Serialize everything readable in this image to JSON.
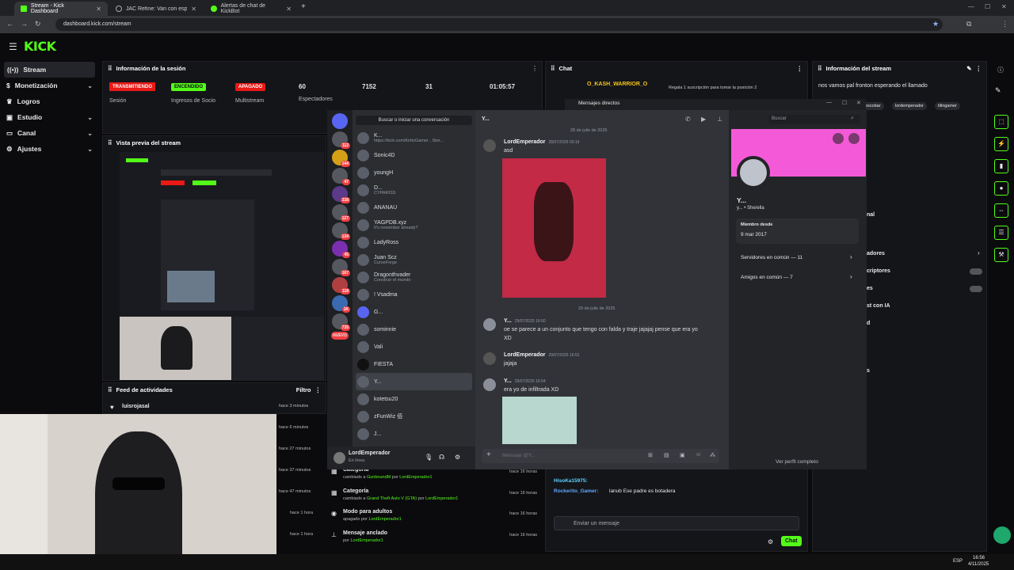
{
  "browser": {
    "tabs": [
      {
        "label": "Stream - Kick Dashboard",
        "active": true
      },
      {
        "label": "JAC Refine: Van con espacio y c...",
        "active": false
      },
      {
        "label": "Alertas de chat de KickBot",
        "active": false
      }
    ],
    "url": "dashboard.kick.com/stream"
  },
  "kick": {
    "logo": "KICK",
    "sidebar": [
      {
        "label": "Stream",
        "icon": "broadcast-icon",
        "active": true,
        "chevron": false
      },
      {
        "label": "Monetización",
        "icon": "coin-icon",
        "active": false,
        "chevron": true
      },
      {
        "label": "Logros",
        "icon": "trophy-icon",
        "active": false,
        "chevron": false
      },
      {
        "label": "Estudio",
        "icon": "studio-icon",
        "active": false,
        "chevron": true
      },
      {
        "label": "Canal",
        "icon": "channel-icon",
        "active": false,
        "chevron": true
      },
      {
        "label": "Ajustes",
        "icon": "gear-icon",
        "active": false,
        "chevron": true
      }
    ],
    "session": {
      "title": "Información de la sesión",
      "stats": [
        {
          "value": "TRANSMITIENDO",
          "label": "Sesión",
          "color": "#e91916"
        },
        {
          "value": "ENCENDIDO",
          "label": "Ingresos de Socio",
          "color": "#53fc18"
        },
        {
          "value": "APAGADO",
          "label": "Multistream",
          "color": "#e91916"
        },
        {
          "value": "60",
          "label": "Espectadores",
          "color": ""
        },
        {
          "value": "7152",
          "label": "",
          "color": ""
        },
        {
          "value": "31",
          "label": "",
          "color": ""
        },
        {
          "value": "01:05:57",
          "label": "",
          "color": ""
        }
      ]
    },
    "preview": {
      "title": "Vista previa del stream"
    },
    "activity": {
      "title": "Feed de actividades",
      "filter": "Filtro",
      "first_user": "luisrojasal",
      "times_left": [
        "hace 3 minutos",
        "hace 6 minutos",
        "hace 27 minutos",
        "hace 37 minutos",
        "hace 47 minutos",
        "hace 1 hora",
        "hace 1 hora"
      ],
      "rows": [
        {
          "title": "Categoría",
          "detail_prefix": "cambiado a",
          "detail_value": "GunboundM",
          "detail_by": "por",
          "user": "LordEmperador1",
          "time": "hace 16 horas",
          "icon": "category-icon"
        },
        {
          "title": "Categoría",
          "detail_prefix": "cambiado a",
          "detail_value": "Grand Theft Auto V (GTA)",
          "detail_by": "por",
          "user": "LordEmperador1",
          "time": "hace 16 horas",
          "icon": "category-icon"
        },
        {
          "title": "Modo para adultos",
          "detail_prefix": "apagado",
          "detail_value": "",
          "detail_by": "por",
          "user": "LordEmperador1",
          "time": "hace 16 horas",
          "icon": "eye-icon"
        },
        {
          "title": "Mensaje anclado",
          "detail_prefix": "",
          "detail_value": "",
          "detail_by": "por",
          "user": "LordEmperador1",
          "time": "hace 16 horas",
          "icon": "pin-icon"
        }
      ]
    },
    "chat": {
      "title": "Chat",
      "top_gifter": "O_KASH_WARRIOR_O",
      "gift_text": "Regala 1 suscripción para tomar la posición 2",
      "messages": [
        {
          "user": "HisoKa15975:",
          "text": ""
        },
        {
          "user": "Rockerito_Gamer:",
          "text": "lanub Ese padre es botadera"
        }
      ],
      "input_placeholder": "Enviar un mensaje",
      "send": "Chat"
    },
    "stream_info": {
      "title": "Información del stream",
      "stream_title": "nos vamos pal fronton esperando el llamado",
      "tags": [
        "escobar",
        "lordemperador",
        "tilingamer"
      ],
      "menu_fragments": [
        "nal",
        "adores",
        "criptores",
        "es",
        "st con IA",
        "d",
        "s"
      ]
    }
  },
  "discord": {
    "header": "Mensajes directos",
    "search": "Buscar o iniciar una conversación",
    "dms": [
      {
        "name": "K...",
        "sub": "https://kick.com/KiritoGamer , Stre..."
      },
      {
        "name": "Sonic4D",
        "sub": ""
      },
      {
        "name": "youngH",
        "sub": ""
      },
      {
        "name": "D...",
        "sub": "CYPARISS"
      },
      {
        "name": "ANANAU",
        "sub": ""
      },
      {
        "name": "YAGPDB.xyz",
        "sub": "It's november already?"
      },
      {
        "name": "LadyRoss",
        "sub": ""
      },
      {
        "name": "Juan Scz",
        "sub": "CurseForge"
      },
      {
        "name": "Dragonthvader",
        "sub": "Construir el mundo"
      },
      {
        "name": "! Vsadma",
        "sub": ""
      },
      {
        "name": "G...",
        "sub": ""
      },
      {
        "name": "sominnie",
        "sub": ""
      },
      {
        "name": "Vali",
        "sub": ""
      },
      {
        "name": "FIESTA",
        "sub": ""
      },
      {
        "name": "Y...",
        "sub": ""
      },
      {
        "name": "kotetsu20",
        "sub": ""
      },
      {
        "name": "zFunWiz 佰",
        "sub": ""
      },
      {
        "name": "J...",
        "sub": ""
      }
    ],
    "rail_badges": [
      "112",
      "144",
      "47",
      "338",
      "127",
      "134",
      "45",
      "167",
      "118",
      "1K",
      "735",
      "NUEVO"
    ],
    "self": {
      "name": "LordEmperador",
      "status": "En línea"
    },
    "chat_header": "Y...",
    "search_box": "Buscar",
    "dates": [
      "28 de julio de 2025",
      "29 de julio de 2025"
    ],
    "messages": [
      {
        "name": "LordEmperador",
        "time": "28/07/2025 00:19",
        "text": "asd"
      },
      {
        "name": "Y...",
        "time": "29/07/2025 16:50",
        "text": "oe se parece a un conjunto que tengo con falda y traje jajajaj pense que era yo"
      },
      {
        "name": "",
        "time": "",
        "text": "XD"
      },
      {
        "name": "LordEmperador",
        "time": "29/07/2025 16:52",
        "text": "jajaja"
      },
      {
        "name": "Y...",
        "time": "29/07/2025 16:54",
        "text": "era yo de infiltrada XD"
      }
    ],
    "composer": "Mensaje @Y...",
    "profile": {
      "name": "Y...",
      "pronouns": "y... • She/ella",
      "member_since_label": "Miembro desde",
      "member_since": "9 mar 2017",
      "servers": "Servidores en común — 11",
      "friends": "Amigos en común — 7",
      "full_profile": "Ver perfil completo",
      "banner_color": "#f45ad8"
    }
  },
  "taskbar": {
    "lang": "ESP",
    "time": "16:56",
    "date": "4/11/2025"
  }
}
